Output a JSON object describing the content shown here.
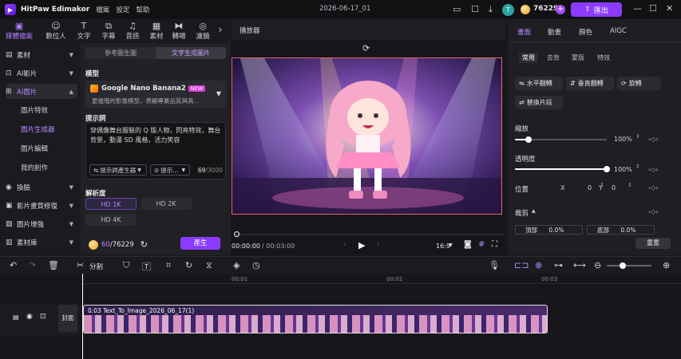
{
  "titlebar": {
    "app_name": "HitPaw Edimakor",
    "menus": [
      "檔案",
      "設定",
      "幫助"
    ],
    "project_name": "2026-06-17_01",
    "avatar_letter": "T",
    "coins": "76229",
    "export_label": "匯出",
    "plus": "+"
  },
  "left_tabs": [
    {
      "icon": "play-icon",
      "label": "媒體檔案"
    },
    {
      "icon": "person-icon",
      "label": "數位人"
    },
    {
      "icon": "text-icon",
      "label": "文字"
    },
    {
      "icon": "subtitle-icon",
      "label": "字幕"
    },
    {
      "icon": "music-icon",
      "label": "音訊"
    },
    {
      "icon": "sticker-icon",
      "label": "素材"
    },
    {
      "icon": "transition-icon",
      "label": "轉場"
    },
    {
      "icon": "filter-icon",
      "label": "濾鏡"
    }
  ],
  "sidebar": {
    "items": [
      {
        "label": "素材"
      },
      {
        "label": "AI影片"
      },
      {
        "label": "AI圖片"
      },
      {
        "label": "換臉"
      },
      {
        "label": "影片畫質修復"
      },
      {
        "label": "圖片增強"
      },
      {
        "label": "素材庫"
      }
    ],
    "sub_items": [
      "圖片特效",
      "圖片生成器",
      "圖片編輯",
      "我的創作"
    ]
  },
  "generator": {
    "seg_left": "參考圖生圖",
    "seg_right": "文字生成圖片",
    "model_label": "模型",
    "model_name": "Google Nano Banana2",
    "model_badge": "NEW",
    "model_desc": "更進階的影像模型，表顯專業品質與高...",
    "prompt_label": "提示詞",
    "prompt_text": "穿偶像舞台服裝的 Q 版人物，閃亮特效，舞台背景，動漫 SD 風格，活力笑容",
    "prompt_gen_btn": "提示詞產生器",
    "prompt_btn2": "提示...",
    "char_count": "69",
    "char_max": "/3000",
    "resolution_label": "解析度",
    "res_options": [
      "HD 1K",
      "HD 2K",
      "HD 4K"
    ],
    "cost": "60",
    "balance": "/76229",
    "generate_label": "產生"
  },
  "player": {
    "title": "播放器",
    "time_current": "00:00:00",
    "time_total": "/ 00:03:00",
    "aspect": "16:9"
  },
  "props": {
    "tabs": [
      "畫面",
      "動畫",
      "顏色",
      "AIGC"
    ],
    "subtabs": [
      "常用",
      "去背",
      "蒙版",
      "特效"
    ],
    "buttons": [
      "水平翻轉",
      "垂直翻轉",
      "旋轉",
      "替換片段"
    ],
    "scale_label": "縮放",
    "scale_value": "100%",
    "scale_level": 0.15,
    "opacity_label": "透明度",
    "opacity_value": "100%",
    "opacity_level": 1.0,
    "position_label": "位置",
    "pos_x_label": "X",
    "pos_x": "0",
    "pos_y_label": "Y",
    "pos_y": "0",
    "crop_label": "裁剪",
    "crop_top_label": "頂部",
    "crop_top": "0.0%",
    "crop_bottom_label": "底部",
    "crop_bottom": "0.0%",
    "reset_label": "重置"
  },
  "toolbar": {
    "split_label": "分割"
  },
  "timeline": {
    "ticks": [
      "00:01",
      "00:02",
      "00:03"
    ],
    "cover_label": "封面",
    "clip_label": "0.03  Text_To_Image_2026_06_17(1)"
  },
  "colors": {
    "accent": "#8b3bff",
    "accent_text": "#b98aff",
    "selection_border": "#e46464"
  }
}
